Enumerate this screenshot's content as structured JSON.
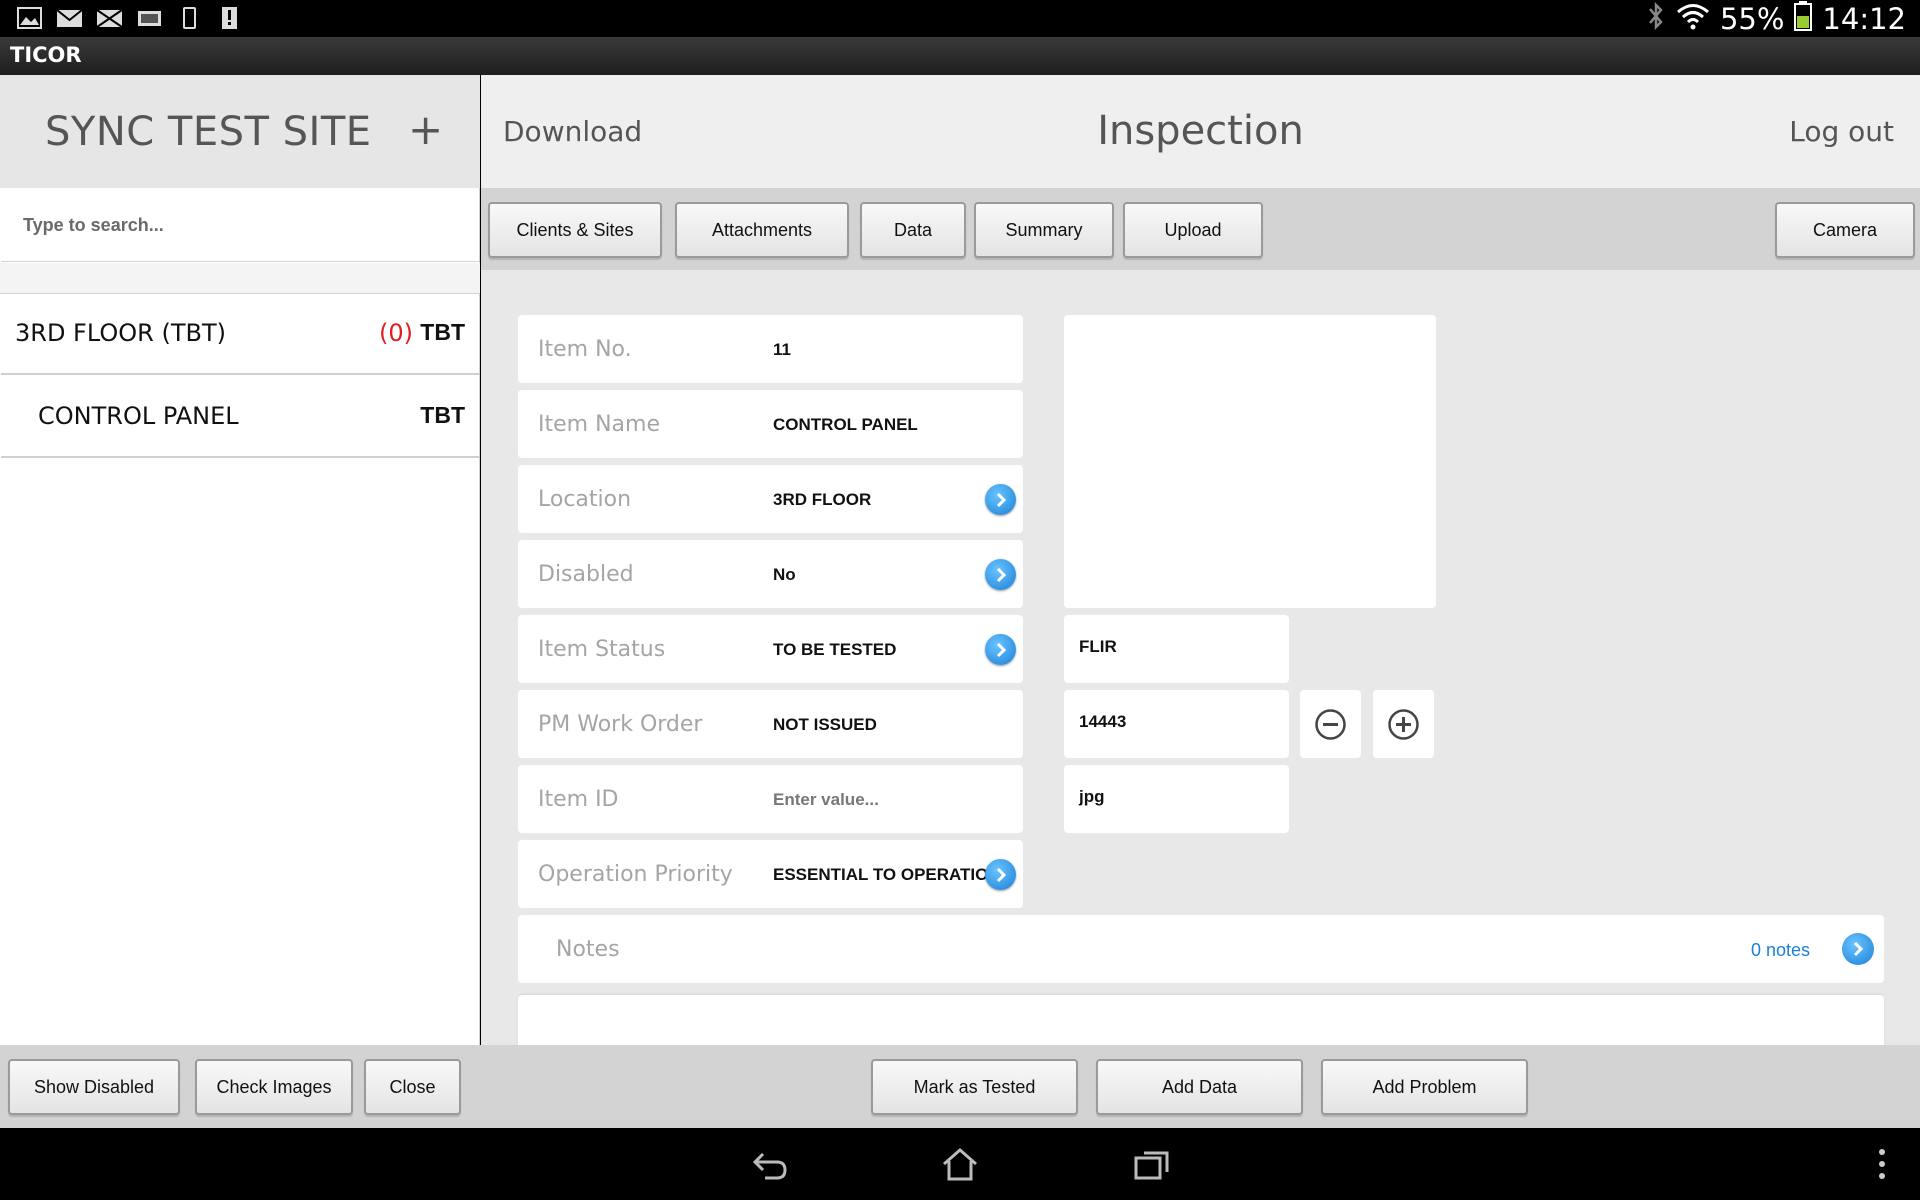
{
  "status_bar": {
    "notifications": [
      "gallery-icon",
      "email-icon",
      "email-closed-icon",
      "card-icon",
      "device-icon",
      "alert-sd-icon"
    ],
    "battery": "55%",
    "time": "14:12"
  },
  "app": {
    "title": "TICOR"
  },
  "sidebar": {
    "site_name": "SYNC TEST SITE",
    "add_label": "+",
    "search_placeholder": "Type to search...",
    "items": [
      {
        "label": "3RD FLOOR (TBT)",
        "count": "(0)",
        "status": "TBT"
      },
      {
        "label": "CONTROL PANEL",
        "count": "",
        "status": "TBT"
      }
    ]
  },
  "header": {
    "download": "Download",
    "title": "Inspection",
    "logout": "Log out"
  },
  "toolbar": {
    "tabs": [
      "Clients & Sites",
      "Attachments",
      "Data",
      "Summary",
      "Upload"
    ],
    "camera": "Camera"
  },
  "form": {
    "fields": [
      {
        "label": "Item No.",
        "value": "11"
      },
      {
        "label": "Item Name",
        "value": "CONTROL PANEL"
      },
      {
        "label": "Location",
        "value": "3RD FLOOR"
      },
      {
        "label": "Disabled",
        "value": "No"
      },
      {
        "label": "Item Status",
        "value": "TO BE TESTED"
      },
      {
        "label": "PM Work Order",
        "value": "NOT ISSUED"
      },
      {
        "label": "Item ID",
        "placeholder": "Enter value..."
      },
      {
        "label": "Operation Priority",
        "value": "ESSENTIAL TO OPERATION"
      }
    ],
    "camera_type": "FLIR",
    "image_number": "14443",
    "file_ext": "jpg",
    "notes_label": "Notes",
    "notes_count": "0 notes"
  },
  "bottom": {
    "show_disabled": "Show Disabled",
    "check_images": "Check Images",
    "close": "Close",
    "mark_tested": "Mark as Tested",
    "add_data": "Add Data",
    "add_problem": "Add Problem"
  },
  "colors": {
    "accent_blue": "#1a7fd6",
    "count_red": "#e02020",
    "toolbar_gray": "#d3d3d3"
  }
}
